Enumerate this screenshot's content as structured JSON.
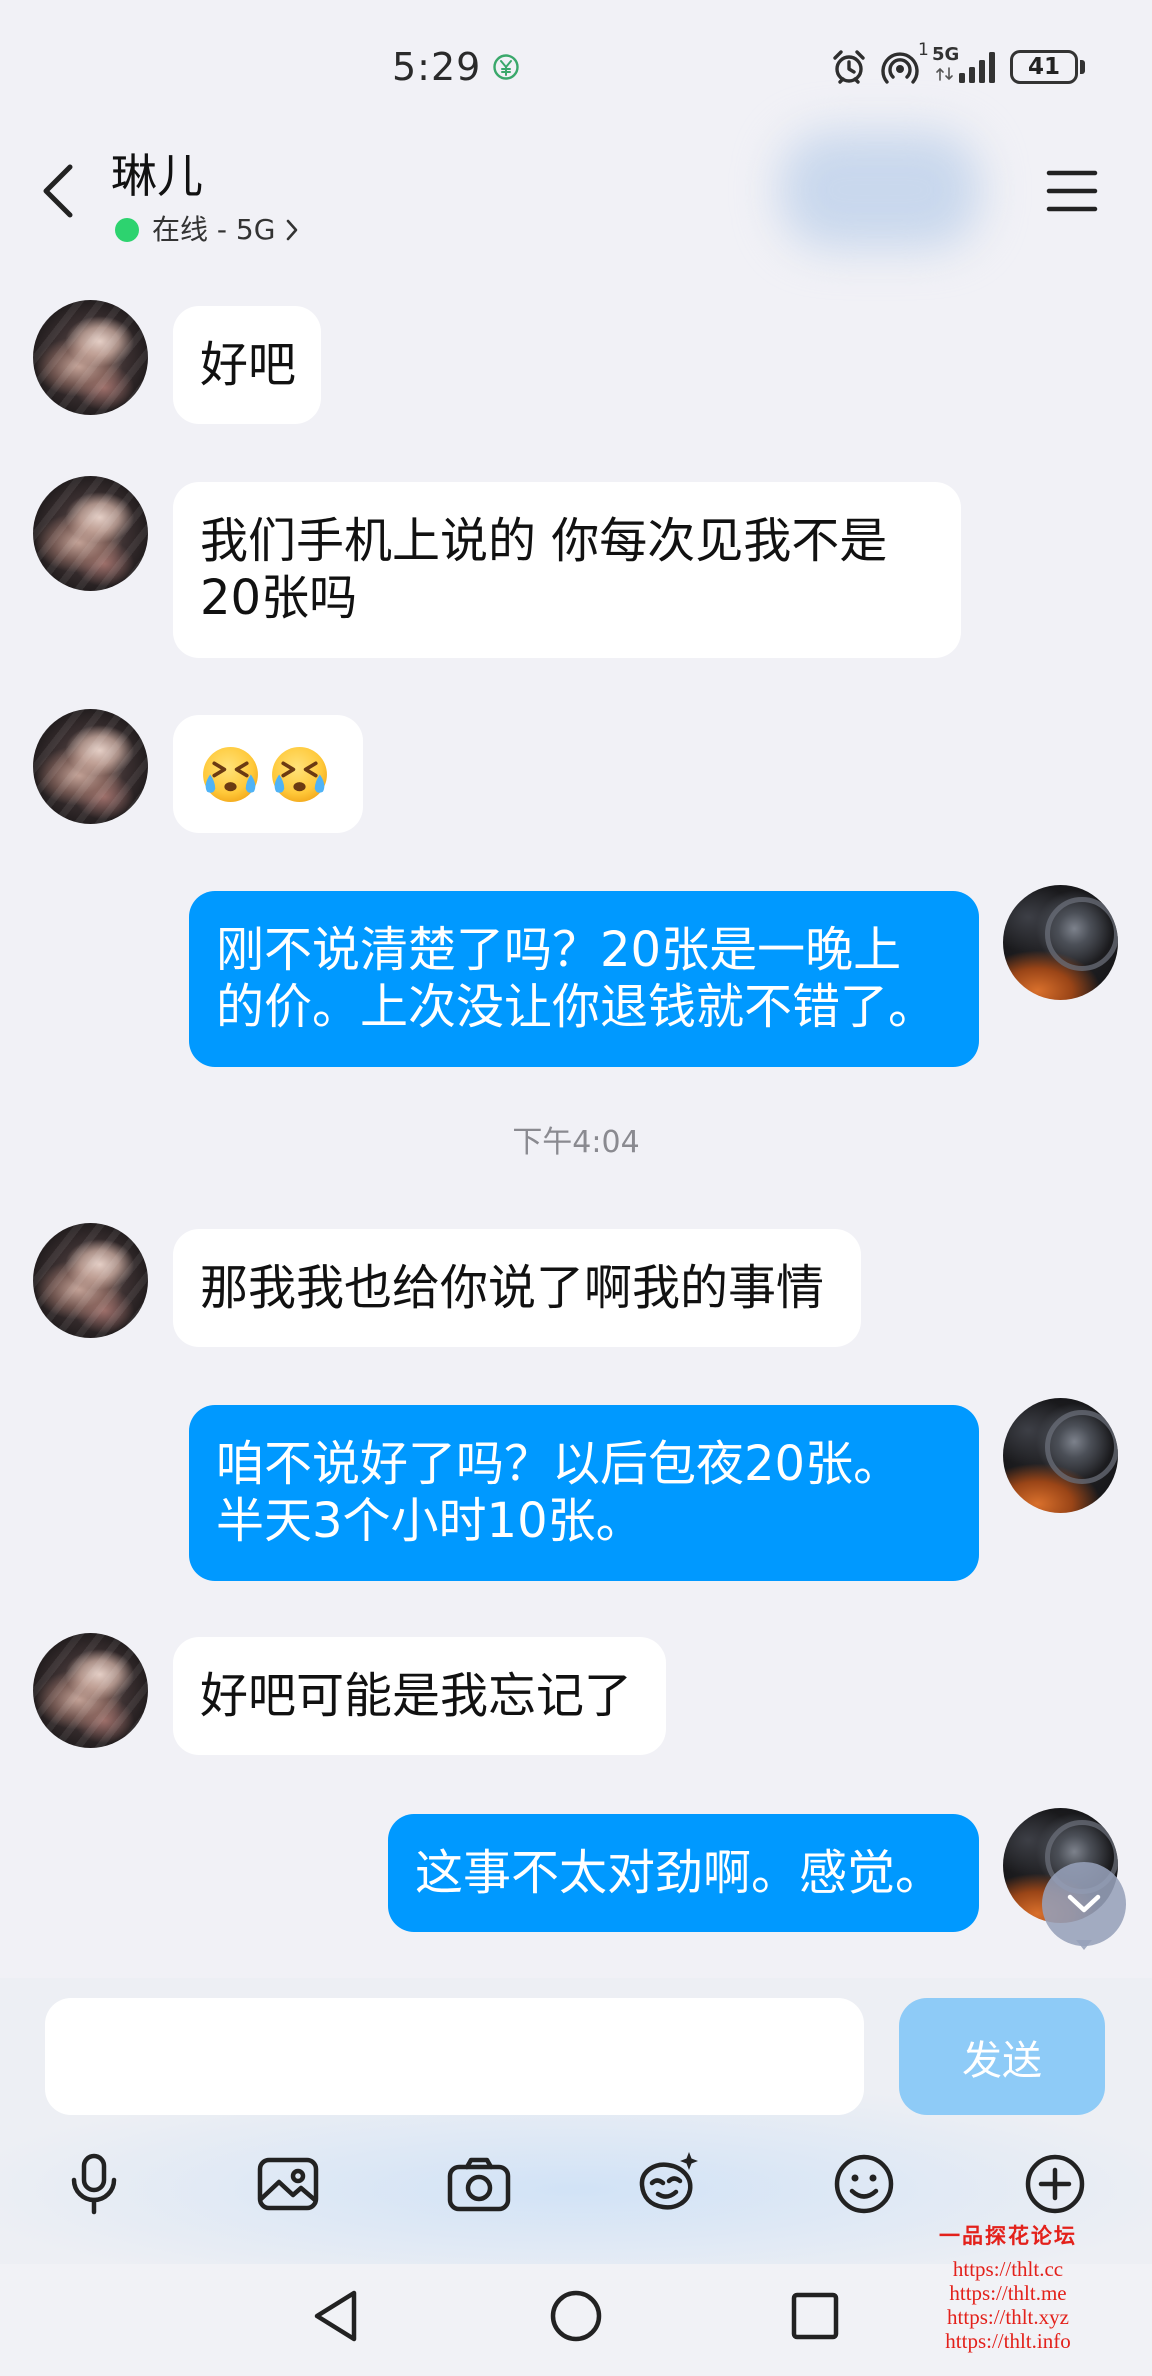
{
  "status_bar": {
    "time": "5:29",
    "hotspot_count": "1",
    "network": "5G",
    "battery": "41",
    "icons": [
      "data-saver-icon",
      "alarm-icon",
      "hotspot-icon",
      "signal-icon",
      "battery-icon"
    ]
  },
  "header": {
    "back_icon": "back-arrow-icon",
    "title": "琳儿",
    "status": "在线 - 5G",
    "status_chevron_icon": "chevron-right-icon",
    "menu_icon": "hamburger-menu-icon"
  },
  "messages": [
    {
      "side": "left",
      "lines": [
        "好吧"
      ]
    },
    {
      "side": "left",
      "lines": [
        "我们手机上说的 你每次见我不是",
        "20张吗"
      ]
    },
    {
      "side": "left",
      "emoji": [
        "crying-laughing-face-icon",
        "crying-laughing-face-icon"
      ]
    },
    {
      "side": "right",
      "lines": [
        "刚不说清楚了吗？20张是一晚上",
        "的价。上次没让你退钱就不错了。"
      ]
    },
    {
      "side": "center",
      "timestamp": "下午4:04"
    },
    {
      "side": "left",
      "lines": [
        "那我我也给你说了啊我的事情"
      ]
    },
    {
      "side": "right",
      "lines": [
        "咱不说好了吗？以后包夜20张。",
        "半天3个小时10张。"
      ]
    },
    {
      "side": "left",
      "lines": [
        "好吧可能是我忘记了"
      ]
    },
    {
      "side": "right",
      "lines": [
        "这事不太对劲啊。感觉。"
      ]
    }
  ],
  "scroll_to_bottom_icon": "chevron-down-icon",
  "composer": {
    "input_value": "",
    "input_placeholder": "",
    "send_label": "发送"
  },
  "toolbar": [
    {
      "icon": "microphone-icon"
    },
    {
      "icon": "image-icon"
    },
    {
      "icon": "camera-icon"
    },
    {
      "icon": "magic-expression-icon"
    },
    {
      "icon": "emoji-icon"
    },
    {
      "icon": "plus-icon"
    }
  ],
  "nav_bar": {
    "icons": [
      "back-triangle-icon",
      "home-circle-icon",
      "recents-square-icon"
    ]
  },
  "watermark": {
    "title": "一品探花论坛",
    "urls": [
      "https://thlt.cc",
      "https://thlt.me",
      "https://thlt.xyz",
      "https://thlt.info"
    ]
  },
  "colors": {
    "background": "#f1f1f6",
    "incoming_bubble": "#ffffff",
    "outgoing_bubble": "#0099ff",
    "send_button": "#8ecbf7",
    "online_dot": "#2dd36f",
    "watermark": "#e3211b"
  }
}
